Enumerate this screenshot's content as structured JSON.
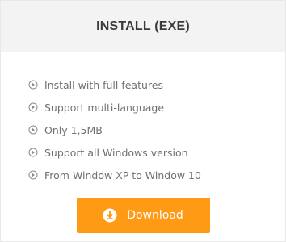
{
  "card": {
    "title": "INSTALL (EXE)"
  },
  "features": [
    {
      "label": "Install with full features",
      "icon": "circle-play-icon"
    },
    {
      "label": "Support multi-language",
      "icon": "circle-play-icon"
    },
    {
      "label": "Only 1,5MB",
      "icon": "circle-play-icon"
    },
    {
      "label": "Support all Windows version",
      "icon": "circle-play-icon"
    },
    {
      "label": "From Window XP to Window 10",
      "icon": "circle-play-icon"
    }
  ],
  "download": {
    "label": "Download",
    "icon": "download-icon"
  },
  "colors": {
    "header_bg": "#f3f3f3",
    "accent": "#ff9a14",
    "text_muted": "#707070",
    "title_text": "#3a3a3a"
  }
}
